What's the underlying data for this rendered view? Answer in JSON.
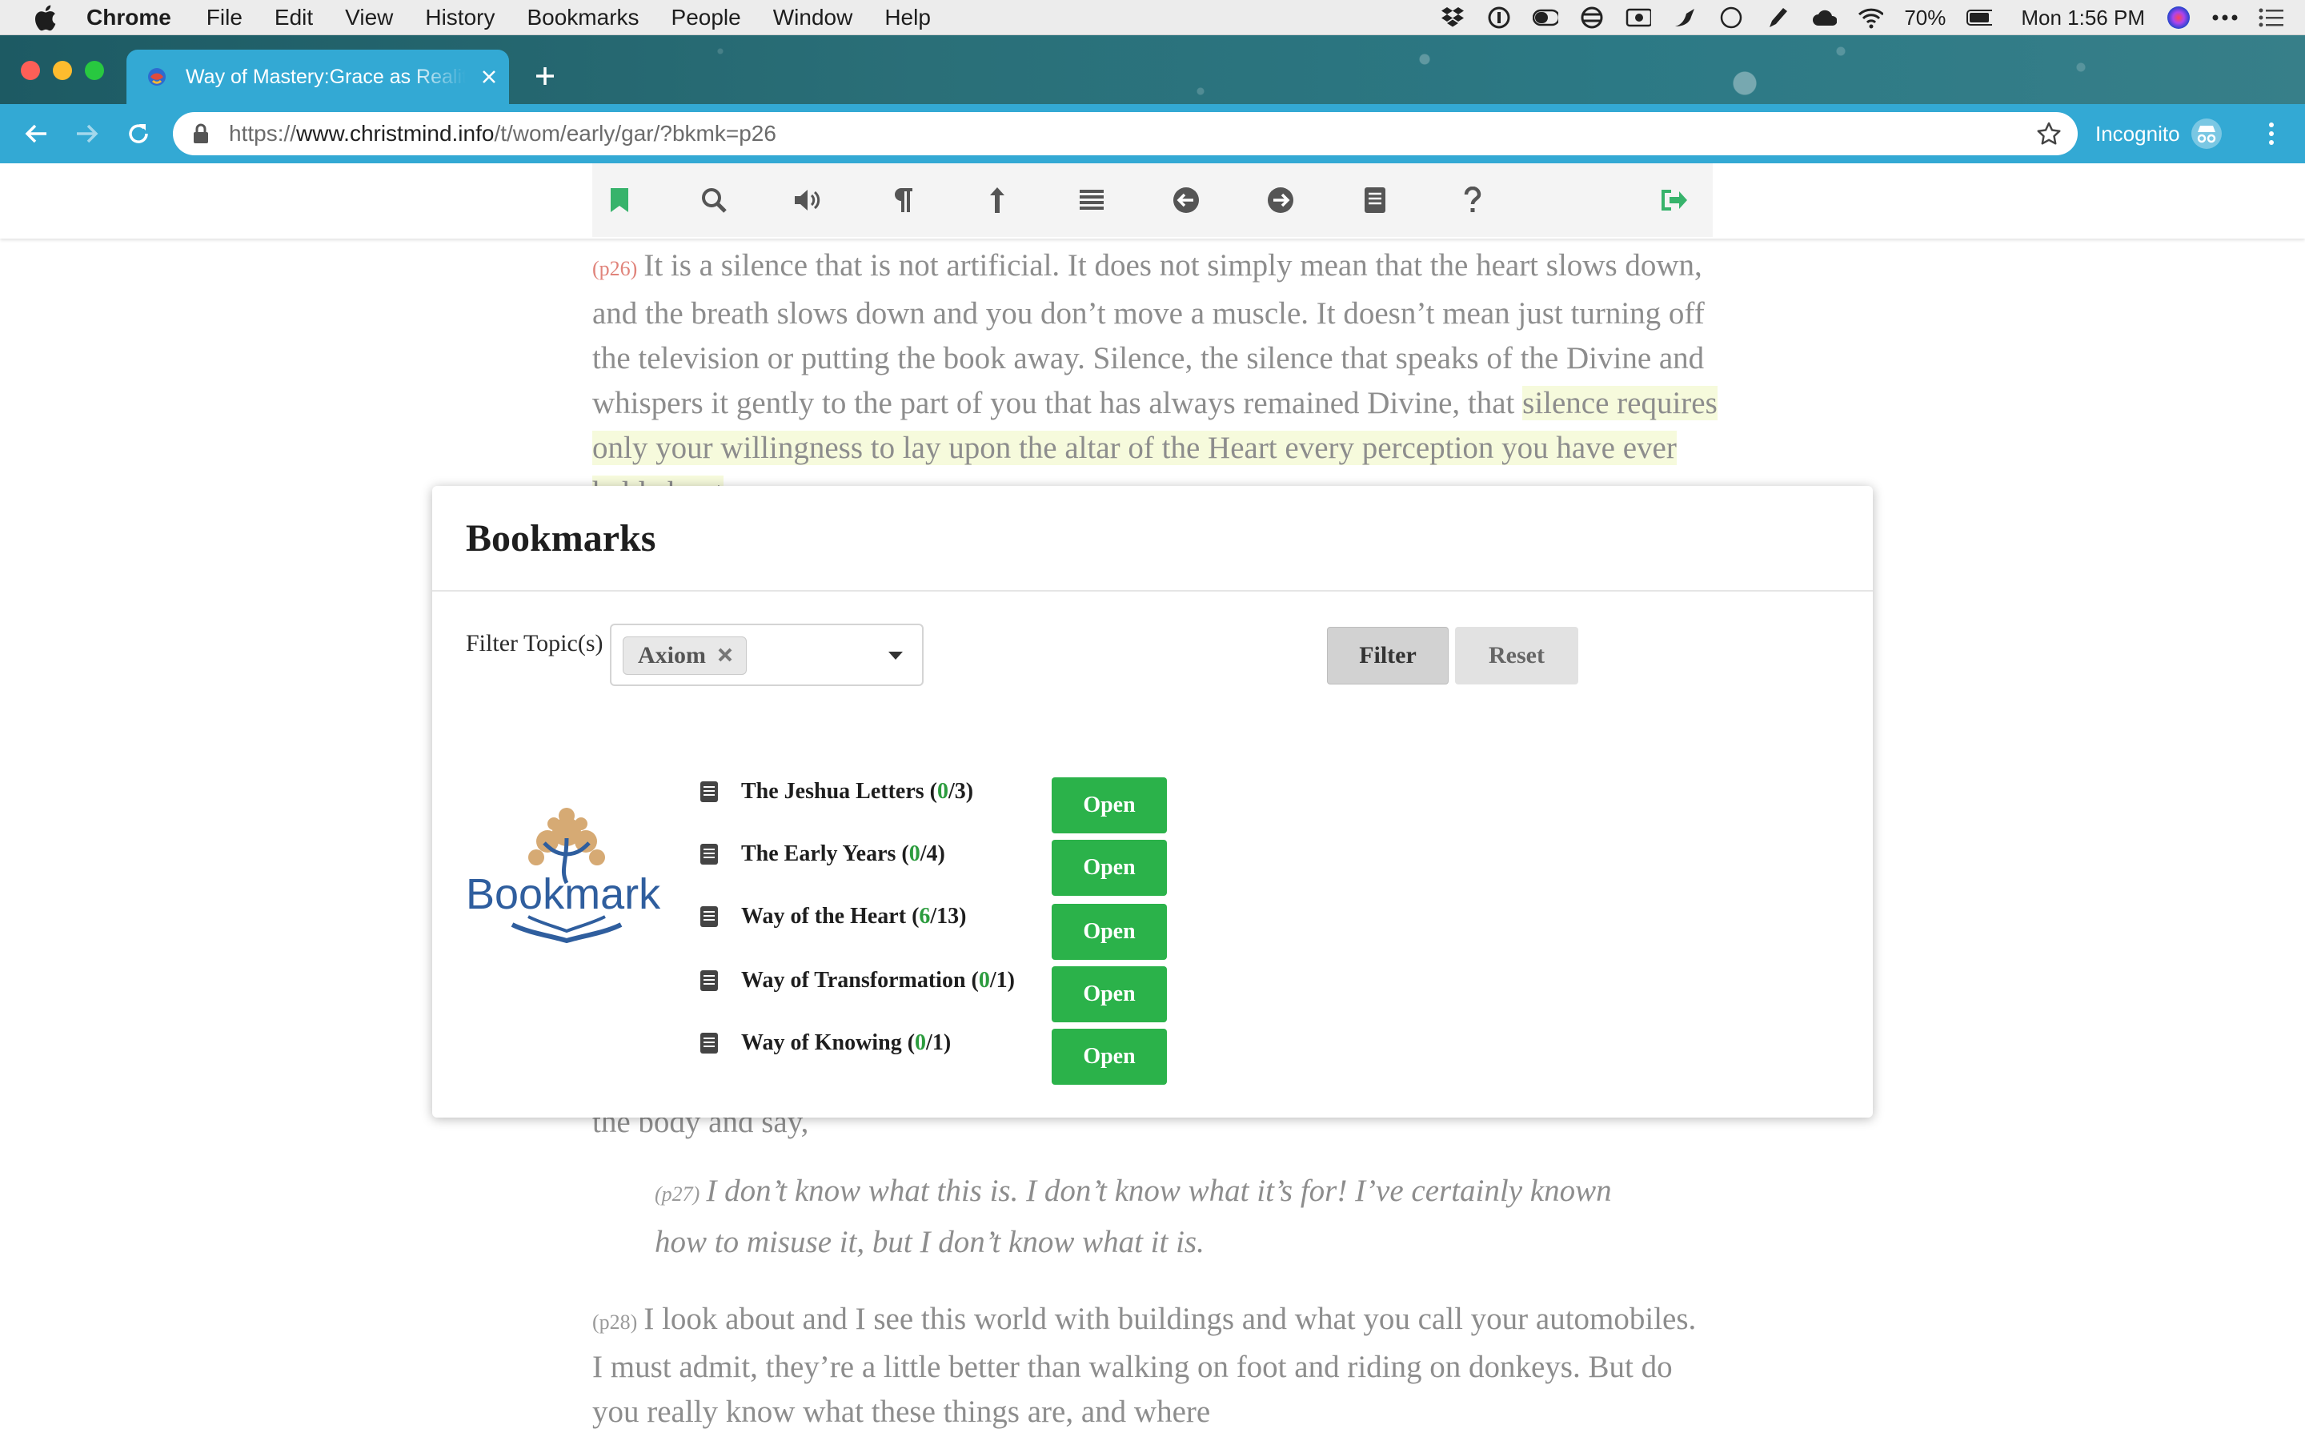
{
  "menubar": {
    "app": "Chrome",
    "items": [
      "File",
      "Edit",
      "View",
      "History",
      "Bookmarks",
      "People",
      "Window",
      "Help"
    ],
    "battery": "70%",
    "clock": "Mon 1:56 PM"
  },
  "browser": {
    "tab_title": "Way of Mastery:Grace as Reality",
    "url_scheme": "https://",
    "url_host": "www.christmind.info",
    "url_path": "/t/wom/early/gar/?bkmk=p26",
    "incognito_label": "Incognito"
  },
  "page": {
    "para26_num": "(p26)",
    "para26_text": "It is a silence that is not artificial. It does not simply mean that the heart slows down, and the breath slows down and you don’t move a muscle. It doesn’t mean just turning off the television or putting the book away. Silence, the silence that speaks of the Divine and whispers it gently to the part of you that has always remained Divine, that ",
    "para26_highlight": "silence requires only your willingness to lay upon the altar of the Heart every perception you have ever held about",
    "fragment": "the body and say,",
    "para27_num": "(p27)",
    "para27_text": "I don’t know what this is. I don’t know what it’s for! I’ve certainly known how to misuse it, but I don’t know what it is.",
    "para28_num": "(p28)",
    "para28_text": "I look about and I see this world with buildings and what you call your automobiles. I must admit, they’re a little better than walking on foot and riding on donkeys. But do you really know what these things are, and where"
  },
  "modal": {
    "title": "Bookmarks",
    "filter_label": "Filter Topic(s)",
    "topic_chip": "Axiom",
    "filter_button": "Filter",
    "reset_button": "Reset",
    "logo_text": "Bookmark",
    "open_label": "Open",
    "books": [
      {
        "name": "The Jeshua Letters",
        "count": "0",
        "total": "3"
      },
      {
        "name": "The Early Years",
        "count": "0",
        "total": "4"
      },
      {
        "name": "Way of the Heart",
        "count": "6",
        "total": "13"
      },
      {
        "name": "Way of Transformation",
        "count": "0",
        "total": "1"
      },
      {
        "name": "Way of Knowing",
        "count": "0",
        "total": "1"
      }
    ]
  },
  "colors": {
    "chrome_accent": "#33a9d4",
    "open_button": "#2bb24a",
    "paragraph_number": "#e0837a",
    "highlight": "#f6fadc"
  }
}
